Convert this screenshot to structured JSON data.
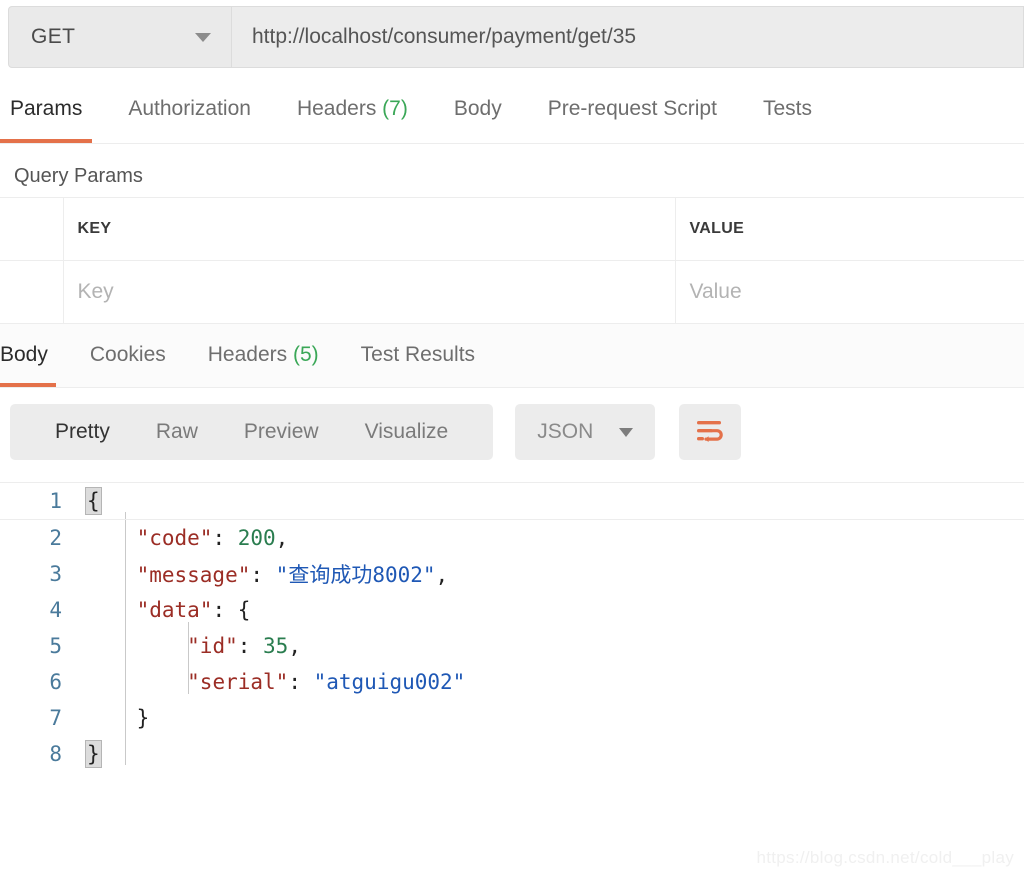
{
  "request": {
    "method": "GET",
    "method_caret_icon": "chevron-down-icon",
    "url": "http://localhost/consumer/payment/get/35",
    "url_placeholder": "Enter request URL",
    "tabs": [
      {
        "label": "Params",
        "count": "",
        "active": true
      },
      {
        "label": "Authorization",
        "count": "",
        "active": false
      },
      {
        "label": "Headers",
        "count": "(7)",
        "active": false
      },
      {
        "label": "Body",
        "count": "",
        "active": false
      },
      {
        "label": "Pre-request Script",
        "count": "",
        "active": false
      },
      {
        "label": "Tests",
        "count": "",
        "active": false
      }
    ]
  },
  "query_params": {
    "title": "Query Params",
    "columns": [
      "KEY",
      "VALUE"
    ],
    "rows": [
      {
        "key_placeholder": "Key",
        "value_placeholder": "Value"
      }
    ]
  },
  "response": {
    "tabs": [
      {
        "label": "Body",
        "count": "",
        "active": true
      },
      {
        "label": "Cookies",
        "count": "",
        "active": false
      },
      {
        "label": "Headers",
        "count": "(5)",
        "active": false
      },
      {
        "label": "Test Results",
        "count": "",
        "active": false
      }
    ],
    "format_modes": [
      {
        "label": "Pretty",
        "active": true
      },
      {
        "label": "Raw",
        "active": false
      },
      {
        "label": "Preview",
        "active": false
      },
      {
        "label": "Visualize",
        "active": false
      }
    ],
    "language_select": {
      "value": "JSON",
      "caret_icon": "chevron-down-icon"
    },
    "wrap_button": {
      "icon": "word-wrap-icon",
      "color": "#e4714a"
    },
    "body_lines": [
      {
        "n": "1",
        "text": "{"
      },
      {
        "n": "2",
        "text": "    \"code\": 200,"
      },
      {
        "n": "3",
        "text": "    \"message\": \"查询成功8002\","
      },
      {
        "n": "4",
        "text": "    \"data\": {"
      },
      {
        "n": "5",
        "text": "        \"id\": 35,"
      },
      {
        "n": "6",
        "text": "        \"serial\": \"atguigu002\""
      },
      {
        "n": "7",
        "text": "    }"
      },
      {
        "n": "8",
        "text": "}"
      }
    ],
    "body_json": {
      "code": 200,
      "message": "查询成功8002",
      "data": {
        "id": 35,
        "serial": "atguigu002"
      }
    }
  },
  "watermark": "https://blog.csdn.net/cold___play",
  "colors": {
    "accent": "#e4714a",
    "count_green": "#3aa757",
    "json_key": "#9b2d25",
    "json_string": "#1f58b5",
    "json_number": "#2a7d4f",
    "line_number": "#4a7a9b"
  }
}
